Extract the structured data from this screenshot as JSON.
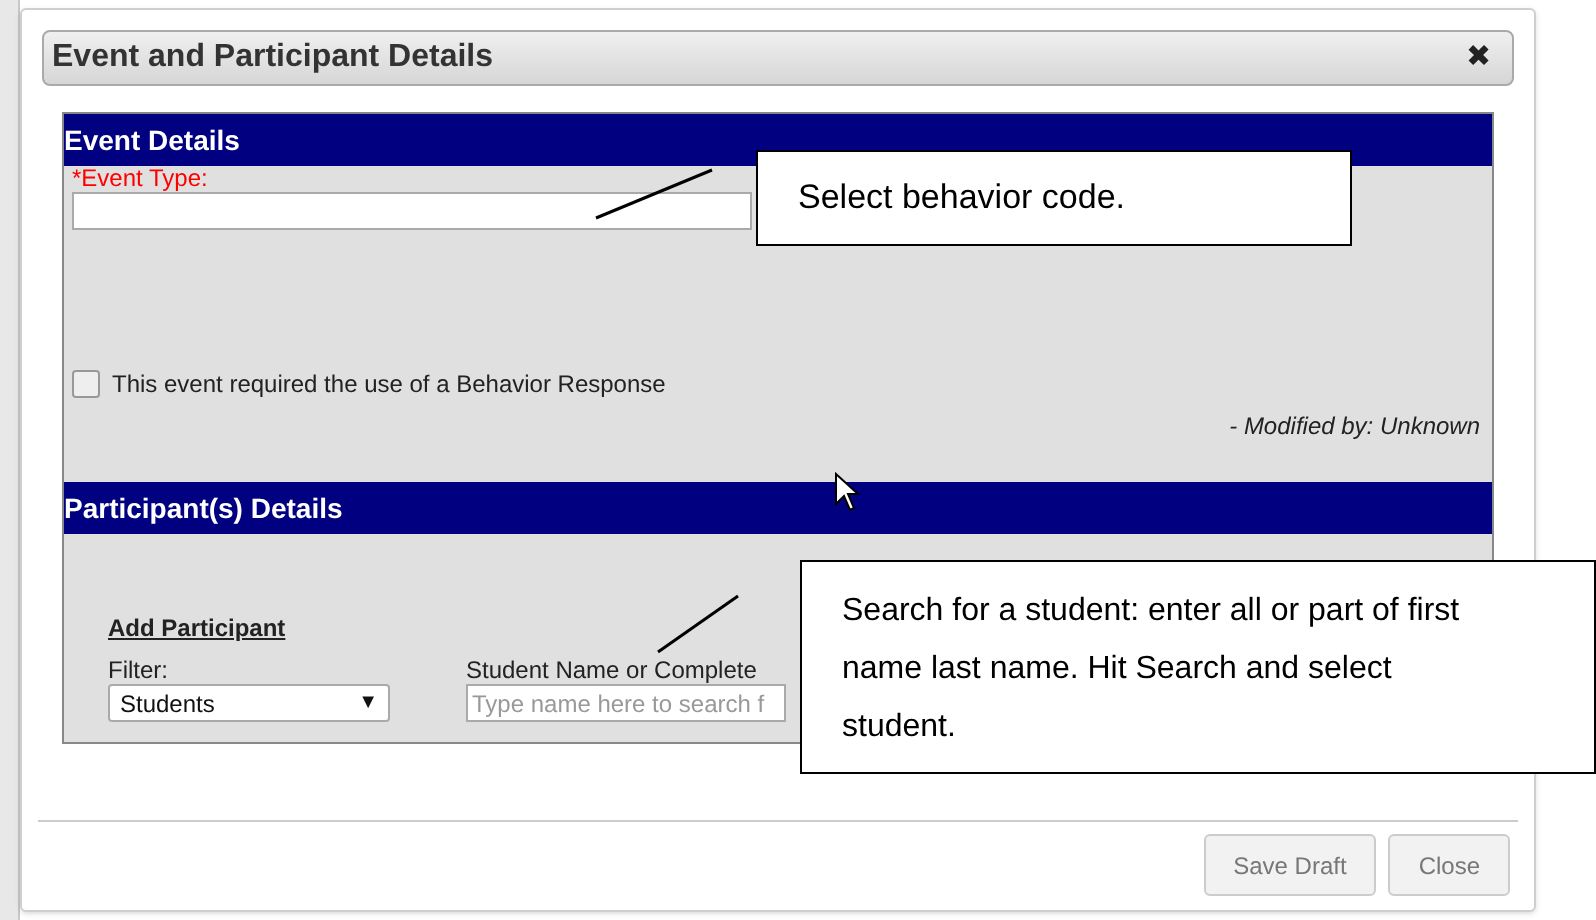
{
  "dialog": {
    "title": "Event and Participant Details",
    "close": "✖"
  },
  "event_details": {
    "header": "Event Details",
    "event_type_label": "*Event Type:",
    "behavior_response": {
      "label": "This event required the use of a Behavior Response",
      "checked": false
    },
    "modified_by": "- Modified by: Unknown"
  },
  "participant_details": {
    "header": "Participant(s) Details",
    "add_participant": "Add Participant",
    "filter_label": "Filter:",
    "filter_value": "Students",
    "filter_caret": "▼",
    "student_label": "Student Name or Complete",
    "student_placeholder": "Type name here to search f"
  },
  "buttons": [
    {
      "label": "Save Draft"
    },
    {
      "label": "Close"
    }
  ],
  "callouts": [
    {
      "text": "Select behavior code."
    },
    {
      "text": "Search for a student: enter all or part of first name last name. Hit Search and select student."
    }
  ]
}
